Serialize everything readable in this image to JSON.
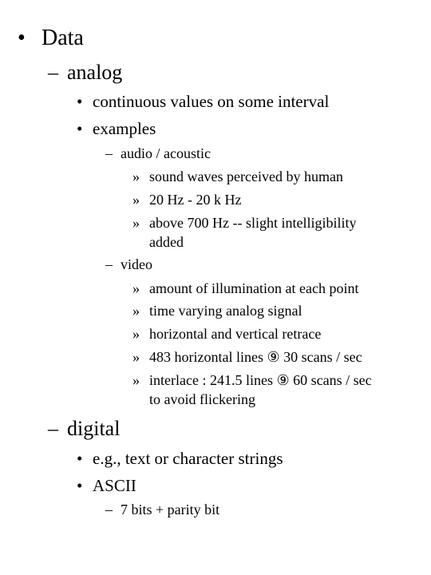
{
  "slide": {
    "bullets": {
      "l1": "•",
      "dash": "–",
      "dot": "•",
      "raquo": "»"
    },
    "title": "Data",
    "analog": {
      "label": "analog",
      "items": [
        "continuous values on some interval",
        "examples"
      ],
      "audio": {
        "label": "audio / acoustic",
        "items": [
          "sound waves perceived by human",
          "20 Hz - 20 k Hz",
          "above 700 Hz -- slight intelligibility",
          "added"
        ]
      },
      "video": {
        "label": "video",
        "items": [
          "amount of illumination at each point",
          "time varying analog signal",
          "horizontal and vertical retrace",
          "483 horizontal lines ⑨ 30 scans / sec",
          "interlace : 241.5 lines ⑨ 60 scans / sec",
          "to avoid flickering"
        ]
      }
    },
    "digital": {
      "label": "digital",
      "items": [
        "e.g., text or character strings",
        "ASCII"
      ],
      "ascii_sub": "7 bits + parity bit"
    }
  }
}
